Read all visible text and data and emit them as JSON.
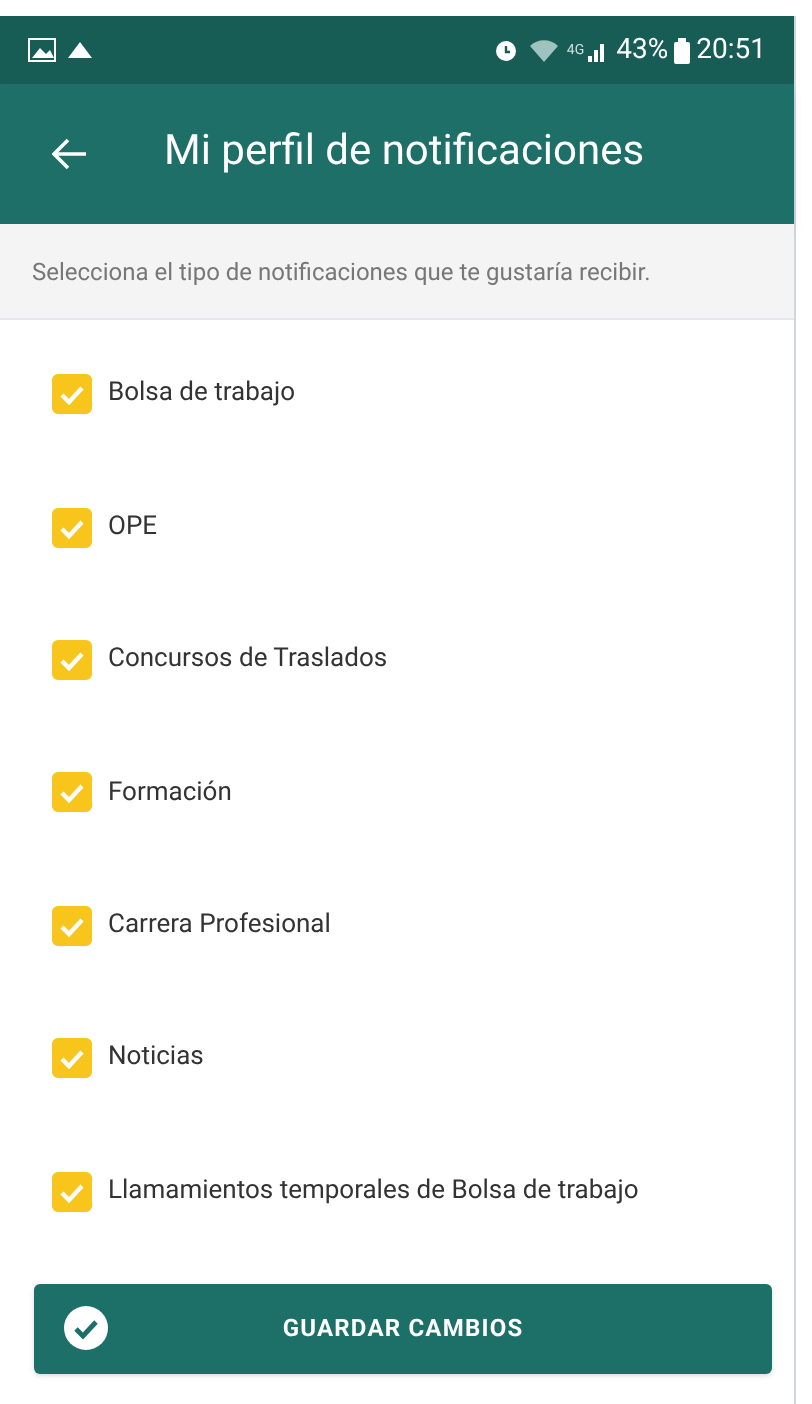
{
  "status_bar": {
    "network": "4G",
    "battery": "43%",
    "time": "20:51"
  },
  "app_bar": {
    "title": "Mi perfil de notificaciones"
  },
  "subtitle": "Selecciona el tipo de notificaciones que te gustaría recibir.",
  "options": [
    {
      "label": "Bolsa de trabajo",
      "checked": true
    },
    {
      "label": "OPE",
      "checked": true
    },
    {
      "label": "Concursos de Traslados",
      "checked": true
    },
    {
      "label": "Formación",
      "checked": true
    },
    {
      "label": "Carrera Profesional",
      "checked": true
    },
    {
      "label": "Noticias",
      "checked": true
    },
    {
      "label": "Llamamientos temporales de Bolsa de trabajo",
      "checked": true
    }
  ],
  "save_button": {
    "label": "GUARDAR CAMBIOS"
  }
}
